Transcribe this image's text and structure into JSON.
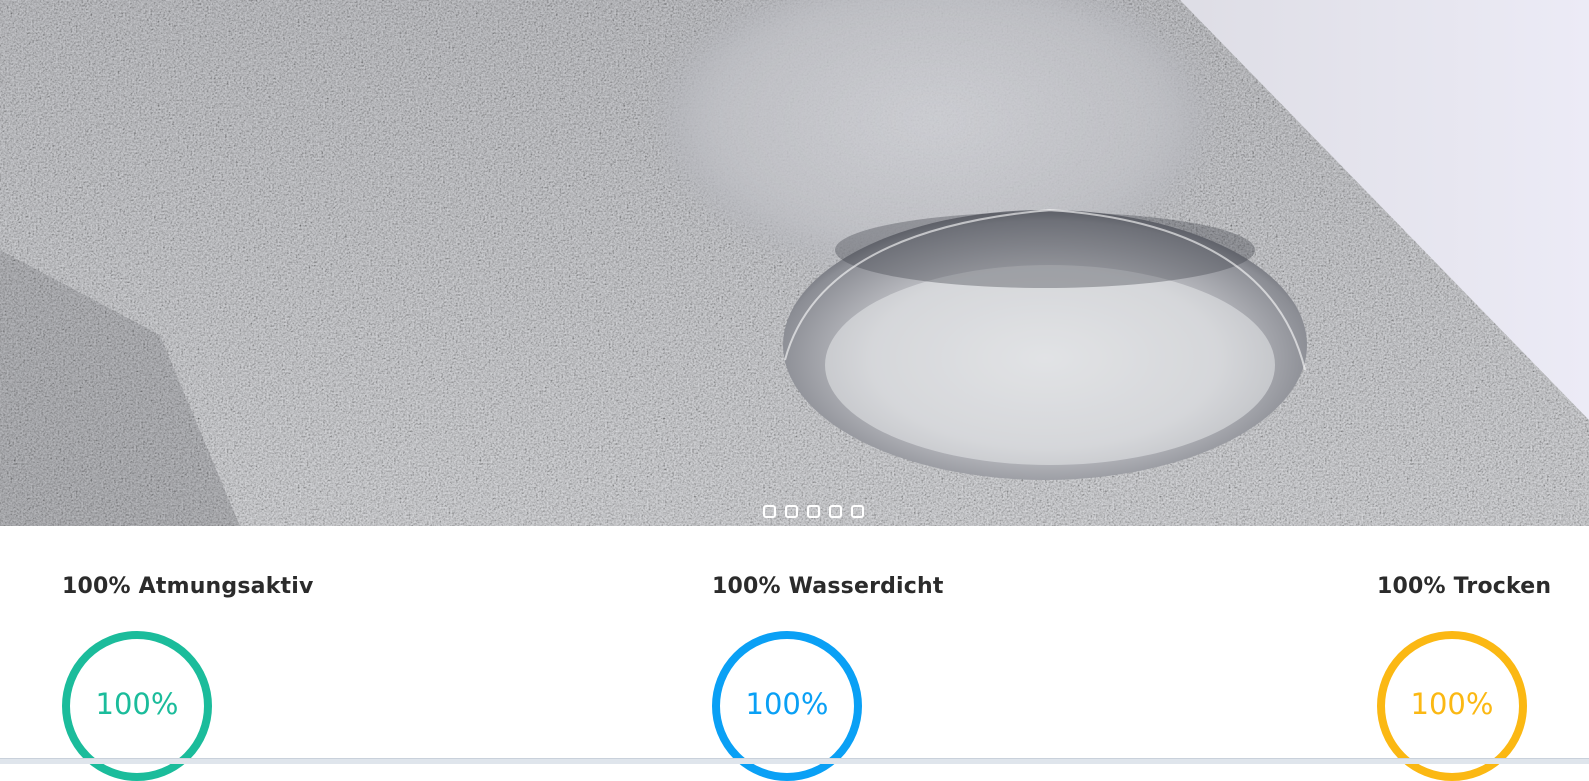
{
  "hero": {
    "slide_count": 5,
    "active_slide": 0
  },
  "stats": [
    {
      "title": "100% Atmungsaktiv",
      "value_label": "100%",
      "fraction": 1.0,
      "color": "#1bbc9b"
    },
    {
      "title": "100% Wasserdicht",
      "value_label": "100%",
      "fraction": 1.0,
      "color": "#0aa0f5"
    },
    {
      "title": "100% Trocken",
      "value_label": "100%",
      "fraction": 1.0,
      "color": "#fbb813"
    }
  ],
  "colors": {
    "title_text": "#2b2b2b",
    "background": "#ffffff"
  }
}
